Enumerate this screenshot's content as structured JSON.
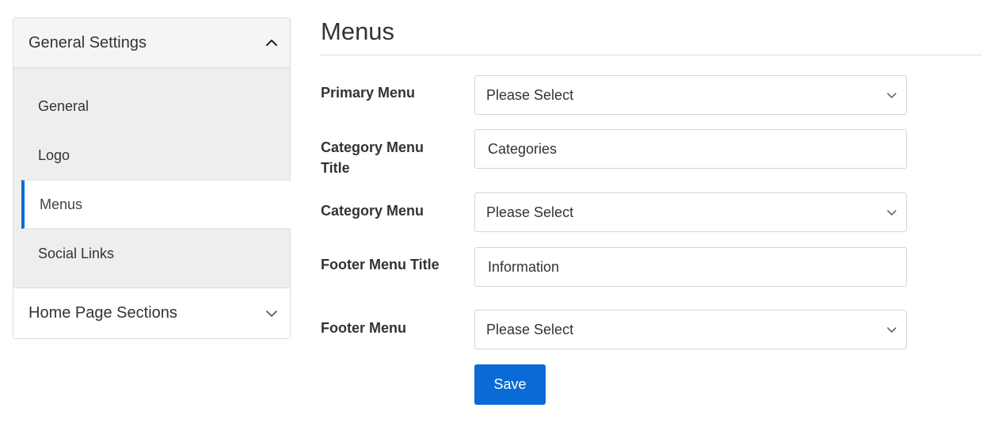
{
  "sidebar": {
    "sections": [
      {
        "label": "General Settings",
        "expanded": true,
        "icon": "chevron-up-icon",
        "items": [
          {
            "label": "General",
            "active": false
          },
          {
            "label": "Logo",
            "active": false
          },
          {
            "label": "Menus",
            "active": true
          },
          {
            "label": "Social Links",
            "active": false
          }
        ]
      },
      {
        "label": "Home Page Sections",
        "expanded": false,
        "icon": "chevron-down-icon"
      }
    ]
  },
  "main": {
    "title": "Menus",
    "fields": [
      {
        "label": "Primary Menu",
        "type": "select",
        "value": "Please Select"
      },
      {
        "label": "Category Menu Title",
        "type": "text",
        "value": "Categories"
      },
      {
        "label": "Category Menu",
        "type": "select",
        "value": "Please Select"
      },
      {
        "label": "Footer Menu Title",
        "type": "text",
        "value": "Information"
      },
      {
        "label": "Footer Menu",
        "type": "select",
        "value": "Please Select"
      }
    ],
    "save_label": "Save"
  },
  "colors": {
    "accent": "#0a6bd6",
    "sidebar_body_bg": "#eeeeee",
    "sidebar_header_bg": "#f5f5f5",
    "border": "#dcdcdc"
  }
}
